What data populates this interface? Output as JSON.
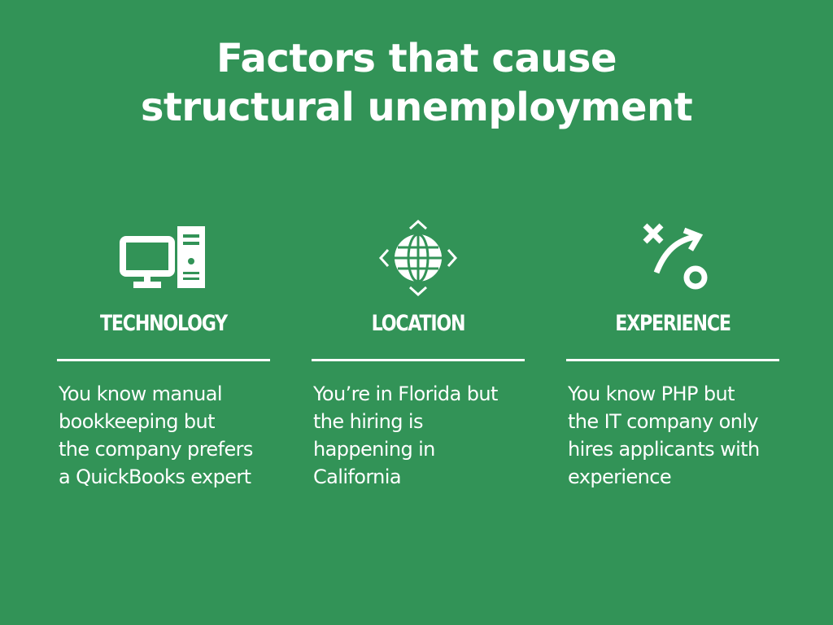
{
  "slide": {
    "title_line1": "Factors that cause",
    "title_line2": "structural unemployment",
    "background_color": "#329357",
    "text_color": "#ffffff"
  },
  "factors": [
    {
      "icon": "computer-icon",
      "heading": "TECHNOLOGY",
      "description": "You know manual\nbookkeeping but\nthe company prefers\na QuickBooks expert"
    },
    {
      "icon": "globe-icon",
      "heading": "LOCATION",
      "description": "You’re in Florida but\nthe hiring is\nhappening in\nCalifornia"
    },
    {
      "icon": "strategy-play-icon",
      "heading": "EXPERIENCE",
      "description": "You know PHP but\nthe IT company only\nhires applicants with\nexperience"
    }
  ]
}
